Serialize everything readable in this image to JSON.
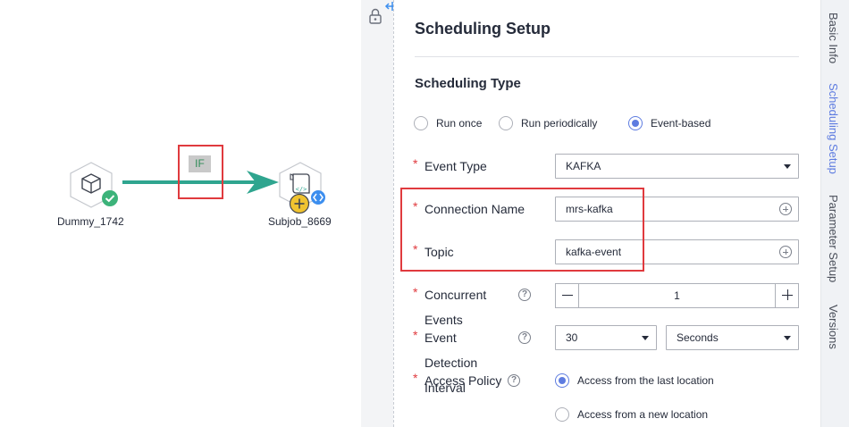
{
  "canvas": {
    "nodes": [
      {
        "label": "Dummy_1742",
        "icon": "cube-icon",
        "status": "success-check-icon"
      },
      {
        "label": "Subjob_8669",
        "icon": "script-icon",
        "status": "add-icon"
      }
    ],
    "edge_tag": "IF",
    "colors": {
      "edge": "#2fa58f",
      "success": "#3cb37a",
      "add": "#f0c330",
      "link": "#3c8eef"
    }
  },
  "panel": {
    "title": "Scheduling Setup",
    "section": "Scheduling Type",
    "schedule_options": [
      {
        "label": "Run once",
        "checked": false
      },
      {
        "label": "Run periodically",
        "checked": false
      },
      {
        "label": "Event-based",
        "checked": true
      }
    ],
    "fields": {
      "event_type": {
        "label": "Event Type",
        "value": "KAFKA"
      },
      "connection_name": {
        "label": "Connection Name",
        "value": "mrs-kafka"
      },
      "topic": {
        "label": "Topic",
        "value": "kafka-event"
      },
      "concurrent": {
        "label": "Concurrent",
        "label_2": "Events",
        "value": "1"
      },
      "event_detection": {
        "label": "Event",
        "label_2": "Detection",
        "label_3": "Interval",
        "value": "30",
        "unit": "Seconds"
      },
      "access_policy": {
        "label": "Access Policy",
        "options": [
          {
            "label": "Access from the last location",
            "checked": true
          },
          {
            "label": "Access from a new location",
            "checked": false
          }
        ]
      }
    },
    "required_mark": "*",
    "help_glyph": "?"
  },
  "tabs": [
    {
      "label": "Basic Info",
      "active": false
    },
    {
      "label": "Scheduling Setup",
      "active": true
    },
    {
      "label": "Parameter Setup",
      "active": false
    },
    {
      "label": "Versions",
      "active": false
    }
  ],
  "accent": "#5e7ce0",
  "highlight_color": "#e03a3e"
}
